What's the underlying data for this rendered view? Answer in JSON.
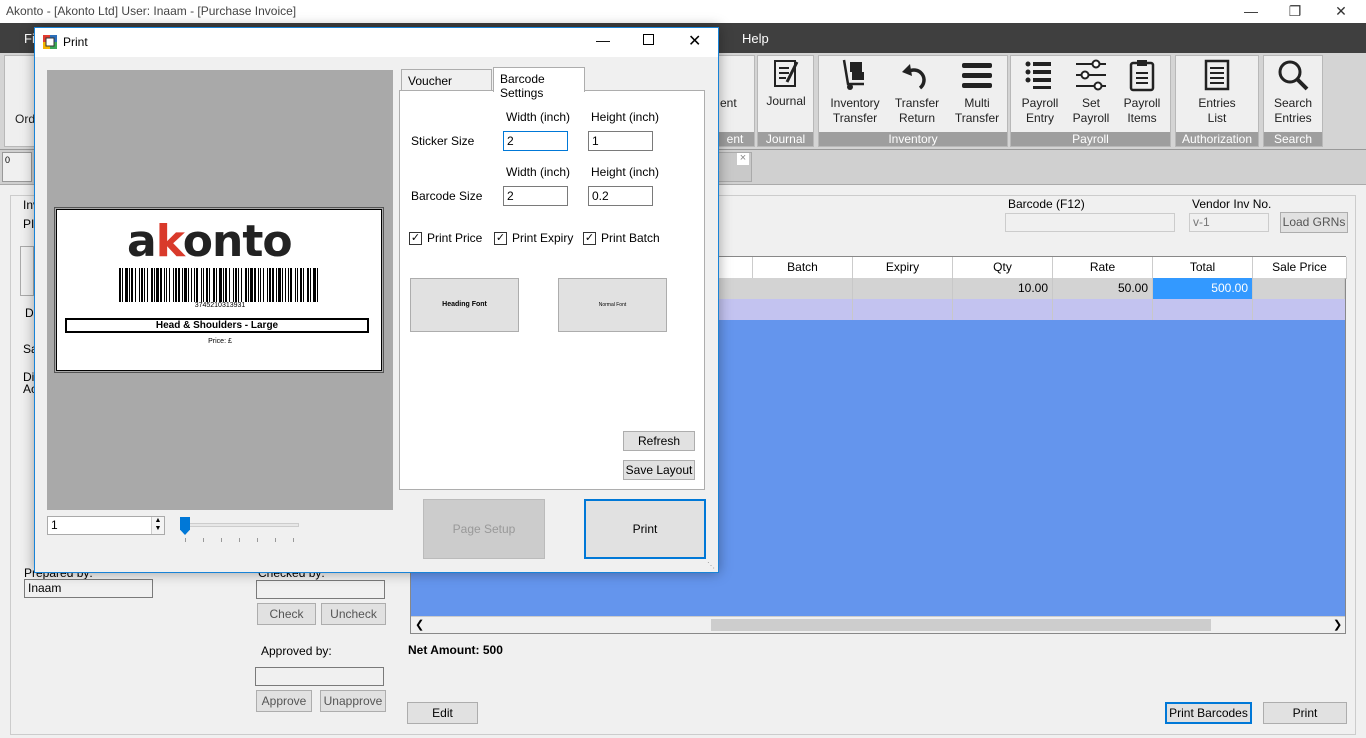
{
  "window": {
    "title": "Akonto - [Akonto Ltd]   User: Inaam - [Purchase Invoice]"
  },
  "menubar": {
    "file": "Fi",
    "help": "Help"
  },
  "ribbon": {
    "left_btn": "Ord",
    "ent_btn": "ent",
    "ent_cap": "ent",
    "journal": {
      "label": "Journal",
      "caption": "Journal"
    },
    "inventory": {
      "caption": "Inventory",
      "items": [
        {
          "l1": "Inventory",
          "l2": "Transfer"
        },
        {
          "l1": "Transfer",
          "l2": "Return"
        },
        {
          "l1": "Multi",
          "l2": "Transfer"
        }
      ]
    },
    "payroll": {
      "caption": "Payroll",
      "items": [
        {
          "l1": "Payroll",
          "l2": "Entry"
        },
        {
          "l1": "Set",
          "l2": "Payroll"
        },
        {
          "l1": "Payroll",
          "l2": "Items"
        }
      ]
    },
    "authorization": {
      "caption": "Authorization",
      "l1": "Entries",
      "l2": "List"
    },
    "search": {
      "caption": "Search",
      "l1": "Search",
      "l2": "Entries"
    }
  },
  "tabstrip": {
    "tab0": "0",
    "tab_close": "×",
    "tab_frag": "e"
  },
  "form": {
    "frag_inv": "Inv",
    "frag_pi": "PI",
    "frag_d": "D",
    "frag_sa": "Sa",
    "frag_di": "Di",
    "frag_ac": "Ac",
    "barcode_label": "Barcode (F12)",
    "barcode_value": "",
    "vendor_inv_label": "Vendor Inv No.",
    "vendor_inv_value": "v-1",
    "load_grns": "Load GRNs",
    "prepared_by_label": "Prepared by:",
    "prepared_by_value": "Inaam",
    "checked_by_label": "Checked by:",
    "checked_by_value": "",
    "check_btn": "Check",
    "uncheck_btn": "Uncheck",
    "approved_by_label": "Approved by:",
    "approved_by_value": "",
    "approve_btn": "Approve",
    "unapprove_btn": "Unapprove",
    "net_amount": "Net Amount: 500",
    "edit_btn": "Edit",
    "print_barcodes_btn": "Print Barcodes",
    "print_btn": "Print"
  },
  "grid": {
    "columns": [
      "Batch",
      "Expiry",
      "Qty",
      "Rate",
      "Total",
      "Sale Price"
    ],
    "rows": [
      [
        "",
        "",
        "10.00",
        "50.00",
        "500.00",
        ""
      ]
    ]
  },
  "dialog": {
    "title": "Print",
    "tabs": [
      "Voucher Settings",
      "Barcode Settings"
    ],
    "width_label": "Width (inch)",
    "height_label": "Height (inch)",
    "sticker_size_label": "Sticker Size",
    "sticker_width": "2",
    "sticker_height": "1",
    "barcode_size_label": "Barcode Size",
    "barcode_width": "2",
    "barcode_height": "0.2",
    "print_price": "Print Price",
    "print_expiry": "Print Expiry",
    "print_batch": "Print Batch",
    "heading_font": "Heading Font",
    "normal_font": "Normal Font",
    "refresh": "Refresh",
    "save_layout": "Save Layout",
    "page_setup": "Page Setup",
    "print": "Print",
    "page_number": "1",
    "preview": {
      "logo": "akonto",
      "barcode_number": "3745210313931",
      "product_name": "Head & Shoulders - Large",
      "price": "Price: £"
    }
  }
}
